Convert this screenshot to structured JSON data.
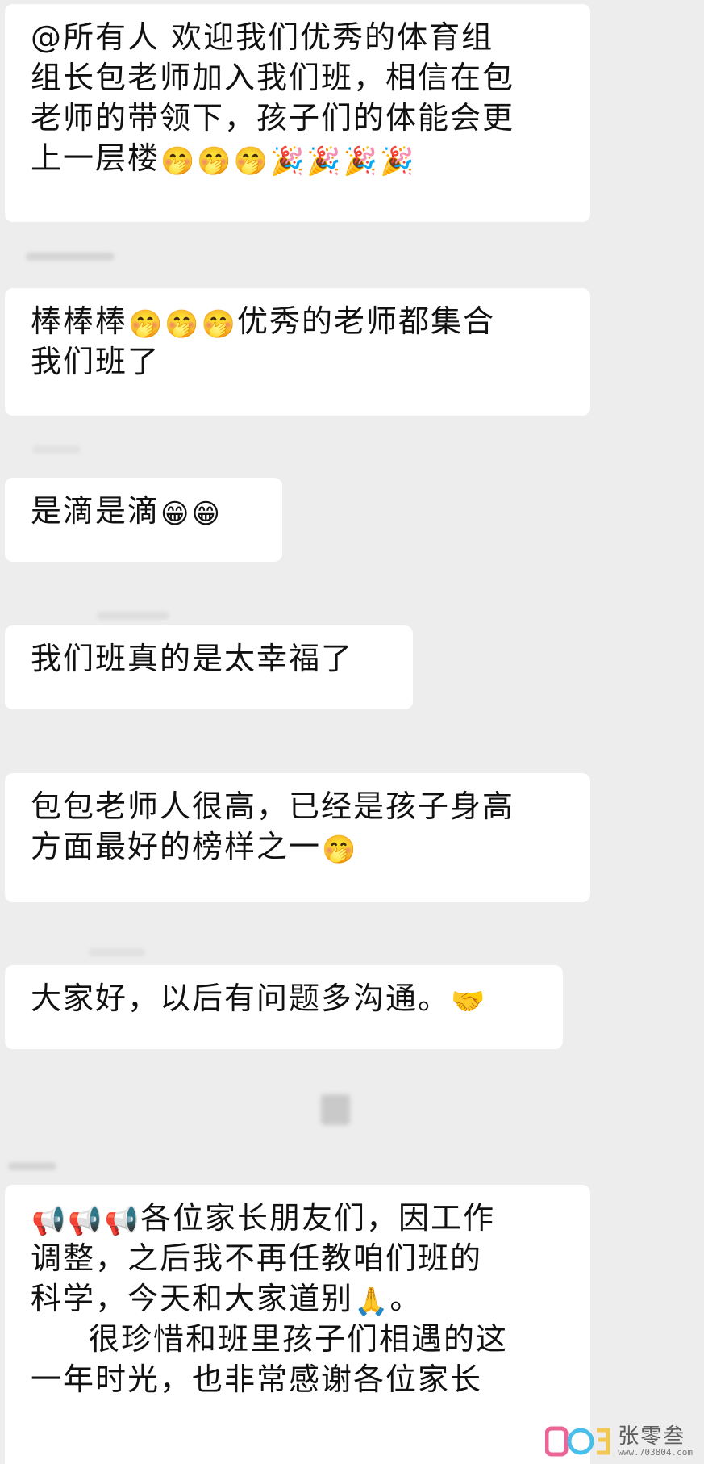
{
  "messages": [
    {
      "id": "welcome",
      "lines": [
        {
          "text": "@所有人  欢迎我们优秀的体育组",
          "emojis": []
        },
        {
          "text": "组长包老师加入我们班，相信在包",
          "emojis": []
        },
        {
          "text": "老师的带领下，孩子们的体能会更",
          "emojis": []
        },
        {
          "text": "上一层楼",
          "emojis": [
            "🤭",
            "🤭",
            "🤭",
            "🎉",
            "🎉",
            "🎉",
            "🎉"
          ]
        }
      ]
    },
    {
      "id": "praise",
      "lines": [
        {
          "pre": "棒棒棒",
          "emojis": [
            "🤭",
            "🤭",
            "🤭"
          ],
          "text": "优秀的老师都集合"
        },
        {
          "text": "我们班了",
          "emojis": []
        }
      ]
    },
    {
      "id": "agree",
      "lines": [
        {
          "text": "是滴是滴",
          "emojis": [
            "😁",
            "😁"
          ]
        }
      ]
    },
    {
      "id": "happy",
      "lines": [
        {
          "text": "我们班真的是太幸福了",
          "emojis": []
        }
      ]
    },
    {
      "id": "tall",
      "lines": [
        {
          "text": "包包老师人很高，已经是孩子身高",
          "emojis": []
        },
        {
          "text": "方面最好的榜样之一",
          "emojis": [
            "🤭"
          ]
        }
      ]
    },
    {
      "id": "hello",
      "lines": [
        {
          "text": "大家好，以后有问题多沟通。",
          "emojis": [
            "🤝"
          ]
        }
      ]
    },
    {
      "id": "farewell",
      "lines": [
        {
          "pre": "",
          "emojis": [
            "📢",
            "📢",
            "📢"
          ],
          "text": "各位家长朋友们，因工作"
        },
        {
          "text": "调整，之后我不再任教咱们班的",
          "emojis": []
        },
        {
          "text": "科学，今天和大家道别",
          "emojis": [
            "🙏"
          ],
          "post": "。"
        },
        {
          "text": "很珍惜和班里孩子们相遇的这",
          "emojis": [],
          "indent": true
        },
        {
          "text": "一年时光，也非常感谢各位家长",
          "emojis": []
        }
      ]
    }
  ],
  "watermark": {
    "name": "张零叁",
    "url": "www.703804.com",
    "logo_colors": [
      "#e94b86",
      "#2ab6e8",
      "#f3c23a"
    ]
  }
}
